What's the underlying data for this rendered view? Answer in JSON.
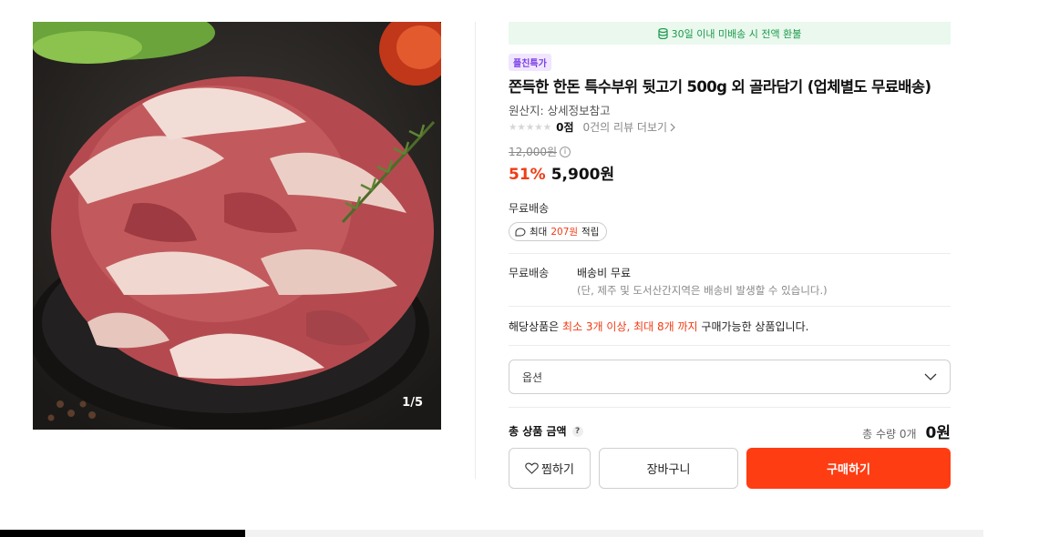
{
  "gallery": {
    "counter": "1/5"
  },
  "banner": {
    "icon": "coin-stack-icon",
    "text": "30일 이내 미배송 시 전액 환불",
    "color": "#1a9a4a"
  },
  "product": {
    "badge": "플친특가",
    "title": "쫀득한 한돈 특수부위 뒷고기 500g 외 골라담기 (업체별도 무료배송)",
    "origin": "원산지: 상세정보참고",
    "rating": {
      "stars_filled": 0,
      "stars_total": 5,
      "score": "0점",
      "reviews_link": "0건의 리뷰 더보기"
    },
    "original_price": "12,000원",
    "discount": "51%",
    "price": "5,900원"
  },
  "shipping": {
    "label": "무료배송",
    "points": {
      "prefix": "최대",
      "amount": "207원",
      "suffix": "적립"
    },
    "row_label": "무료배송",
    "fee_text": "배송비 무료",
    "note": "(단, 제주 및 도서산간지역은 배송비 발생할 수 있습니다.)"
  },
  "purchase_limit": {
    "prefix": "해당상품은",
    "highlight": "최소 3개 이상, 최대 8개 까지",
    "suffix": "구매가능한 상품입니다."
  },
  "option": {
    "placeholder": "옵션"
  },
  "total": {
    "label": "총 상품 금액",
    "help": "?",
    "quantity": "총 수량 0개",
    "amount": "0원"
  },
  "buttons": {
    "wishlist": "찜하기",
    "cart": "장바구니",
    "buy": "구매하기"
  },
  "colors": {
    "accent": "#ff3d13",
    "discount": "#f03c14",
    "badge_bg": "#f0e6ff",
    "badge_fg": "#7b3fe4"
  }
}
